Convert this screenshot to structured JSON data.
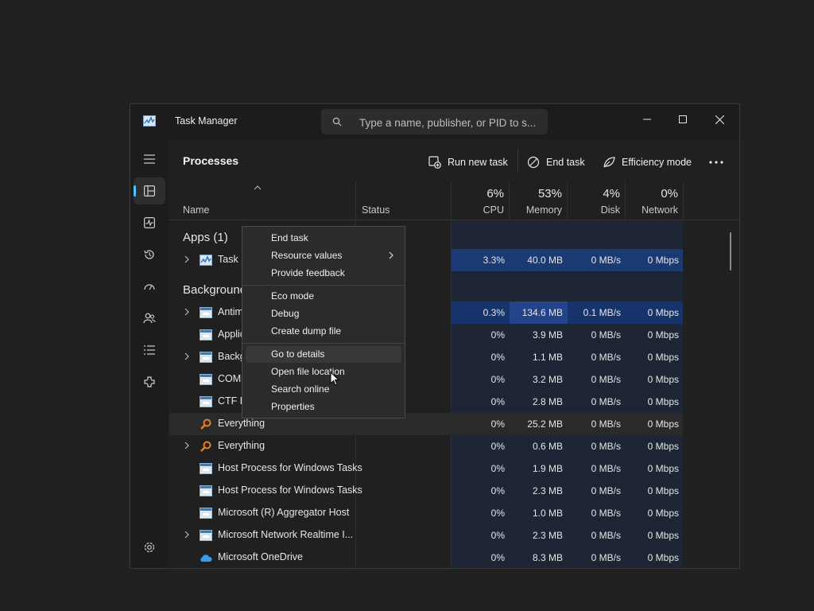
{
  "window": {
    "title": "Task Manager",
    "search_placeholder": "Type a name, publisher, or PID to s..."
  },
  "nav": {
    "items": [
      {
        "icon": "hamburger-icon"
      },
      {
        "icon": "processes-icon",
        "active": true
      },
      {
        "icon": "performance-icon"
      },
      {
        "icon": "app-history-icon"
      },
      {
        "icon": "startup-apps-icon"
      },
      {
        "icon": "users-icon"
      },
      {
        "icon": "details-icon"
      },
      {
        "icon": "services-icon"
      },
      {
        "icon": "settings-icon"
      }
    ]
  },
  "toolbar": {
    "page_title": "Processes",
    "run_new_task": "Run new task",
    "end_task": "End task",
    "efficiency_mode": "Efficiency mode"
  },
  "columns": {
    "name": "Name",
    "status": "Status",
    "cpu_pct": "6%",
    "cpu": "CPU",
    "memory_pct": "53%",
    "memory": "Memory",
    "disk_pct": "4%",
    "disk": "Disk",
    "network_pct": "0%",
    "network": "Network"
  },
  "groups": {
    "apps": "Apps (1)",
    "background": "Background processes"
  },
  "processes": [
    {
      "name": "Task Manager",
      "expandable": true,
      "cpu": "3.3%",
      "memory": "40.0 MB",
      "disk": "0 MB/s",
      "network": "0 Mbps"
    },
    {
      "name": "Antimalware Service Executable",
      "expandable": true,
      "cpu": "0.3%",
      "memory": "134.6 MB",
      "disk": "0.1 MB/s",
      "network": "0 Mbps"
    },
    {
      "name": "Application Frame Host",
      "expandable": false,
      "cpu": "0%",
      "memory": "3.9 MB",
      "disk": "0 MB/s",
      "network": "0 Mbps"
    },
    {
      "name": "Background Task Host",
      "expandable": true,
      "cpu": "0%",
      "memory": "1.1 MB",
      "disk": "0 MB/s",
      "network": "0 Mbps"
    },
    {
      "name": "COM Surrogate",
      "expandable": false,
      "cpu": "0%",
      "memory": "3.2 MB",
      "disk": "0 MB/s",
      "network": "0 Mbps"
    },
    {
      "name": "CTF Loader",
      "expandable": false,
      "cpu": "0%",
      "memory": "2.8 MB",
      "disk": "0 MB/s",
      "network": "0 Mbps"
    },
    {
      "name": "Everything",
      "expandable": false,
      "cpu": "0%",
      "memory": "25.2 MB",
      "disk": "0 MB/s",
      "network": "0 Mbps"
    },
    {
      "name": "Everything",
      "expandable": true,
      "cpu": "0%",
      "memory": "0.6 MB",
      "disk": "0 MB/s",
      "network": "0 Mbps"
    },
    {
      "name": "Host Process for Windows Tasks",
      "expandable": false,
      "cpu": "0%",
      "memory": "1.9 MB",
      "disk": "0 MB/s",
      "network": "0 Mbps"
    },
    {
      "name": "Host Process for Windows Tasks",
      "expandable": false,
      "cpu": "0%",
      "memory": "2.3 MB",
      "disk": "0 MB/s",
      "network": "0 Mbps"
    },
    {
      "name": "Microsoft (R) Aggregator Host",
      "expandable": false,
      "cpu": "0%",
      "memory": "1.0 MB",
      "disk": "0 MB/s",
      "network": "0 Mbps"
    },
    {
      "name": "Microsoft Network Realtime I...",
      "expandable": true,
      "cpu": "0%",
      "memory": "2.3 MB",
      "disk": "0 MB/s",
      "network": "0 Mbps"
    },
    {
      "name": "Microsoft OneDrive",
      "expandable": false,
      "cpu": "0%",
      "memory": "8.3 MB",
      "disk": "0 MB/s",
      "network": "0 Mbps"
    }
  ],
  "context_menu": {
    "items": [
      "End task",
      "Resource values",
      "Provide feedback",
      "Eco mode",
      "Debug",
      "Create dump file",
      "Go to details",
      "Open file location",
      "Search online",
      "Properties"
    ]
  },
  "colors": {
    "accent": "#4cc2ff",
    "heat_low": "#16346b",
    "heat_high": "#22448a",
    "everything_icon": "#e8801d",
    "onedrive_icon": "#3a9be8"
  }
}
